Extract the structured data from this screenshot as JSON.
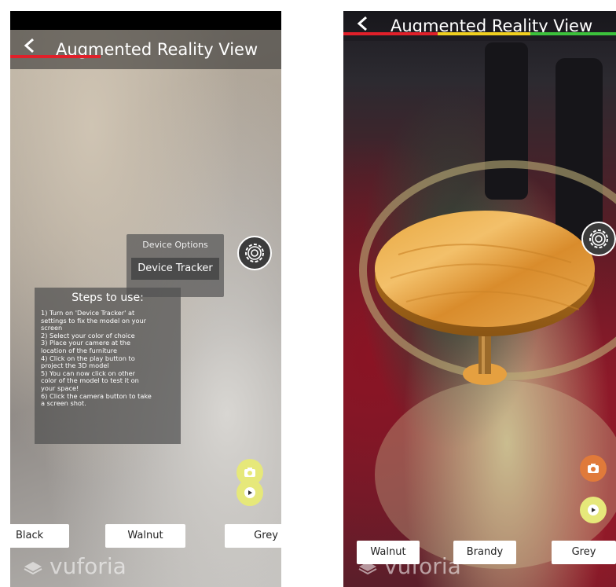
{
  "left": {
    "header": {
      "back_icon": "chevron-left-icon",
      "title": "Augmented Reality View"
    },
    "device_options": {
      "label": "Device Options",
      "button": "Device Tracker"
    },
    "steps": {
      "heading": "Steps to use:",
      "lines": [
        "1) Turn on 'Device Tracker' at",
        "settings to fix the model on your",
        "screen",
        "2) Select your color of choice",
        "3) Place your  camere at the",
        "location of the furniture",
        "4) Click on the play button to",
        "project the 3D model",
        "5) You can now click on other",
        "color of the model to test it on",
        "your space!",
        "6) Click the camera button to take",
        "a screen shot."
      ]
    },
    "color_buttons": [
      "Black",
      "Walnut",
      "Grey"
    ],
    "logo": "vuforia",
    "progress_colors": [
      "#e0202a"
    ]
  },
  "right": {
    "header": {
      "back_icon": "chevron-left-icon",
      "title": "Augmented Reality View"
    },
    "color_buttons": [
      "Walnut",
      "Brandy",
      "Grey"
    ],
    "logo": "vuforia",
    "progress_colors": [
      "#e0202a",
      "#f0d020",
      "#3cc23c"
    ]
  },
  "colors": {
    "camera_btn_left": "#e6e87a",
    "play_btn": "#e6e87a",
    "camera_btn_right": "#e07a3a"
  }
}
